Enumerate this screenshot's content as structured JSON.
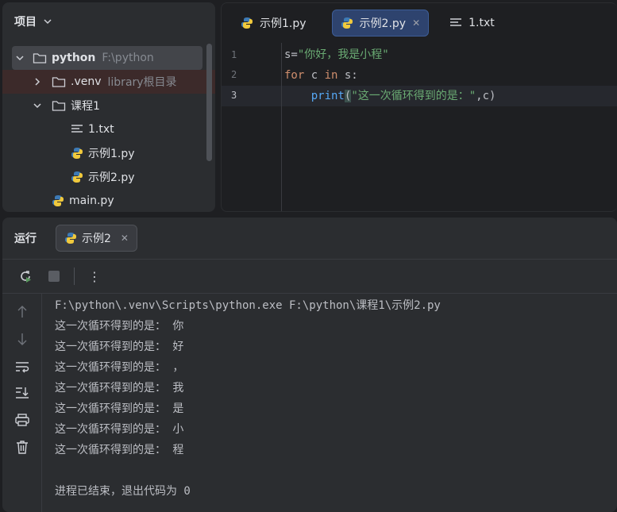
{
  "project": {
    "title": "项目",
    "tree": {
      "root": {
        "label": "python",
        "hint": "F:\\python"
      },
      "venv": {
        "label": ".venv",
        "hint": "library根目录"
      },
      "course": {
        "label": "课程1"
      },
      "txt": {
        "label": "1.txt"
      },
      "ex1": {
        "label": "示例1.py"
      },
      "ex2": {
        "label": "示例2.py"
      },
      "main": {
        "label": "main.py"
      }
    }
  },
  "editor": {
    "tabs": [
      {
        "label": "示例1.py"
      },
      {
        "label": "示例2.py",
        "close": "✕"
      },
      {
        "label": "1.txt"
      }
    ],
    "line_numbers": [
      "1",
      "2",
      "3"
    ],
    "code": {
      "l1_s": "s=",
      "l1_str": "\"你好，我是小程\"",
      "l2_for": "for",
      "l2_mid": " c ",
      "l2_in": "in",
      "l2_end": " s:",
      "l3_indent": "    ",
      "l3_fn": "print",
      "l3_open": "(",
      "l3_str": "\"这一次循环得到的是：\"",
      "l3_rest": ",c)"
    }
  },
  "run": {
    "title": "运行",
    "tab_label": "示例2",
    "tab_close": "✕",
    "more": "⋮",
    "console": [
      "F:\\python\\.venv\\Scripts\\python.exe F:\\python\\课程1\\示例2.py",
      "这一次循环得到的是： 你",
      "这一次循环得到的是： 好",
      "这一次循环得到的是： ，",
      "这一次循环得到的是： 我",
      "这一次循环得到的是： 是",
      "这一次循环得到的是： 小",
      "这一次循环得到的是： 程",
      "",
      "进程已结束，退出代码为 0"
    ]
  },
  "colors": {
    "accent": "#3574f0",
    "python_blue": "#3d7ab5",
    "python_yellow": "#f0c93d"
  }
}
